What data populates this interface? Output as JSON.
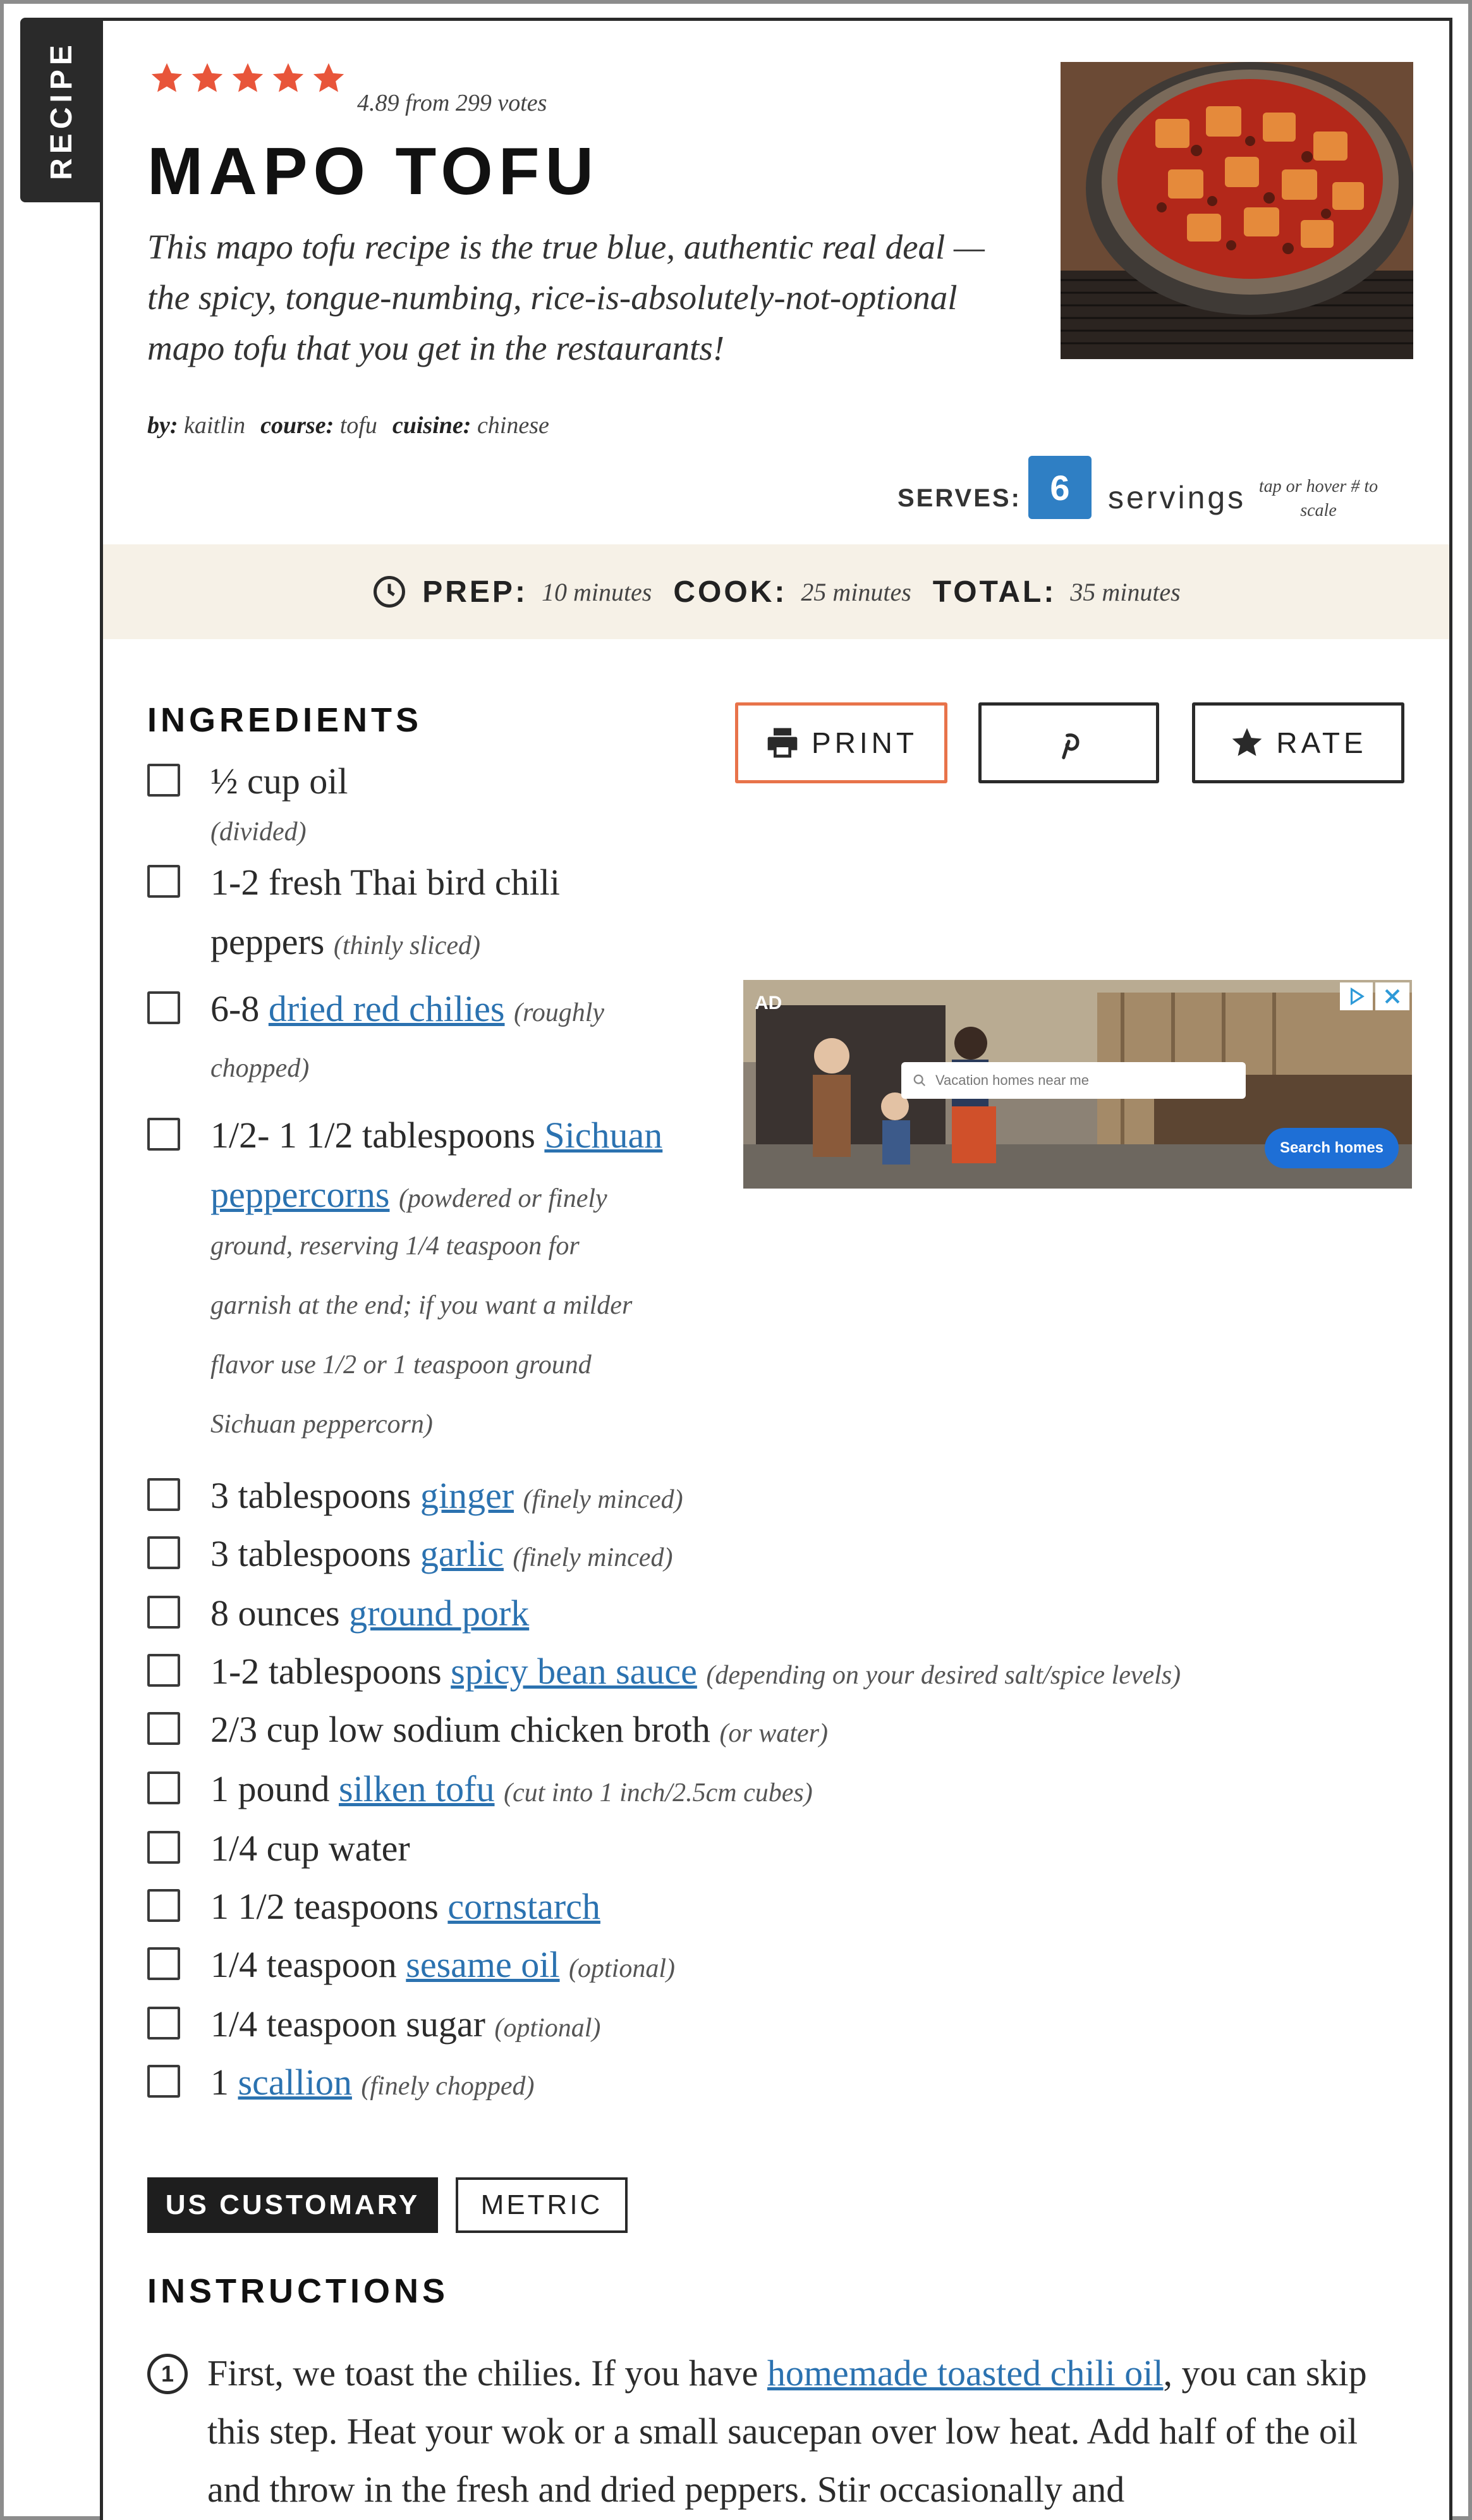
{
  "tab_label": "RECIPE",
  "rating": {
    "stars": 5,
    "text": "4.89 from 299 votes"
  },
  "title": "MAPO TOFU",
  "description": "This mapo tofu recipe is the true blue, authentic real deal —the spicy, tongue-numbing, rice-is-absolutely-not-optional mapo tofu that you get in the restaurants!",
  "meta": {
    "by_label": "by:",
    "by_value": "kaitlin",
    "course_label": "course:",
    "course_value": "tofu",
    "cuisine_label": "cuisine:",
    "cuisine_value": "chinese"
  },
  "serves": {
    "label": "SERVES:",
    "value": "6",
    "unit": "servings",
    "hint": "tap or hover # to scale"
  },
  "times": {
    "prep_label": "PREP:",
    "prep_value": "10 minutes",
    "cook_label": "COOK:",
    "cook_value": "25 minutes",
    "total_label": "TOTAL:",
    "total_value": "35 minutes"
  },
  "ingredients_heading": "INGREDIENTS",
  "buttons": {
    "print": "PRINT",
    "rate": "RATE"
  },
  "ingredients": [
    {
      "qty": "½ cup oil",
      "note": "(divided)"
    },
    {
      "qty": "1-2 fresh Thai bird chili",
      "qty2": "peppers",
      "note": "(thinly sliced)"
    },
    {
      "qty": "6-8",
      "link": "dried red chilies",
      "note": "(roughly",
      "note2": "chopped)"
    },
    {
      "qty": "1/2- 1 1/2 tablespoons",
      "link": "Sichuan",
      "link2": "peppercorns",
      "note": "(powdered or finely",
      "note_lines": [
        "ground, reserving 1/4 teaspoon for",
        "garnish at the end; if you want a milder",
        "flavor use 1/2 or 1 teaspoon ground",
        "Sichuan peppercorn)"
      ]
    },
    {
      "qty": "3 tablespoons",
      "link": "ginger",
      "note": "(finely minced)"
    },
    {
      "qty": "3 tablespoons",
      "link": "garlic",
      "note": "(finely minced)"
    },
    {
      "qty": "8 ounces",
      "link": "ground pork"
    },
    {
      "qty": "1-2 tablespoons",
      "link": "spicy bean sauce",
      "note": "(depending on your desired salt/spice levels)"
    },
    {
      "qty": "2/3 cup low sodium chicken broth",
      "note": "(or water)"
    },
    {
      "qty": "1 pound",
      "link": "silken tofu",
      "note": "(cut into 1 inch/2.5cm cubes)"
    },
    {
      "qty": "1/4 cup water"
    },
    {
      "qty": "1 1/2 teaspoons",
      "link": "cornstarch"
    },
    {
      "qty": "1/4 teaspoon",
      "link": "sesame oil",
      "note": "(optional)"
    },
    {
      "qty": "1/4 teaspoon sugar",
      "note": "(optional)"
    },
    {
      "qty": "1",
      "link": "scallion",
      "note": "(finely chopped)"
    }
  ],
  "ad": {
    "badge": "AD",
    "search_placeholder": "Vacation homes near me",
    "cta": "Search homes"
  },
  "units": {
    "us": "US CUSTOMARY",
    "metric": "METRIC"
  },
  "instructions_heading": "INSTRUCTIONS",
  "step1": {
    "num": "1",
    "before": "First, we toast the chilies. If you have",
    "link": "homemade toasted chili oil",
    "after": ", you can skip this step. Heat your wok or a small saucepan over low heat. Add half of the oil and throw in the fresh and dried peppers. Stir occasionally and"
  },
  "colors": {
    "star": "#e8553a",
    "link": "#2b72b0",
    "serves_badge": "#2f7fc4",
    "timebar_bg": "#f6f1e7",
    "print_border": "#e8734a"
  }
}
